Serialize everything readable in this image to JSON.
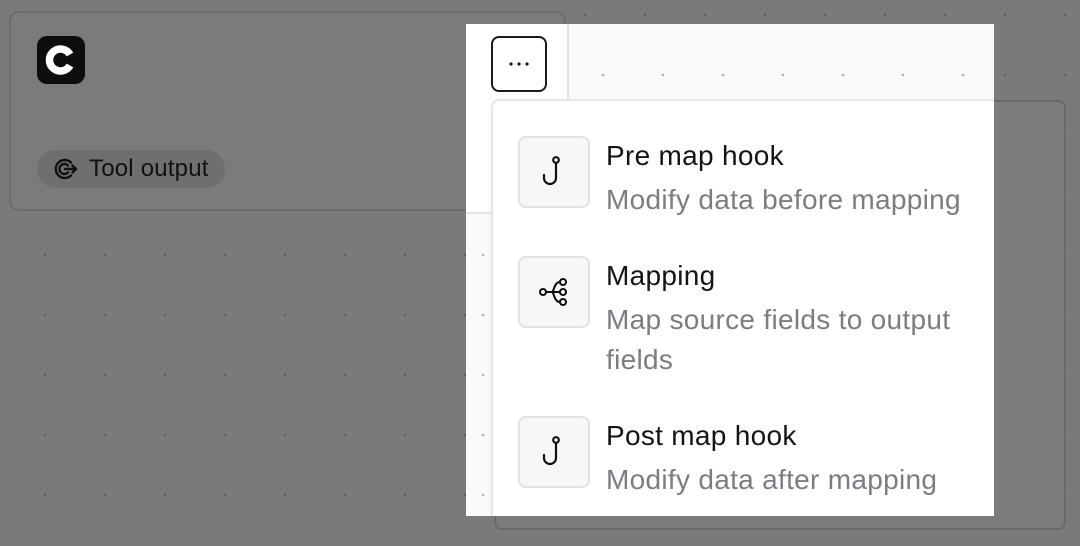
{
  "node": {
    "logo_icon": "letter-c-logo",
    "chip": {
      "icon": "tool-output-icon",
      "label": "Tool output"
    }
  },
  "toolbar": {
    "more_icon": "ellipsis-icon"
  },
  "menu": {
    "items": [
      {
        "icon": "hook-icon",
        "title": "Pre map hook",
        "description": "Modify data before mapping"
      },
      {
        "icon": "mapping-icon",
        "title": "Mapping",
        "description": "Map source fields to output fields"
      },
      {
        "icon": "hook-icon",
        "title": "Post map hook",
        "description": "Modify data after mapping"
      }
    ]
  },
  "colors": {
    "backdrop": "#7a7a7a",
    "menu_background": "#ffffff",
    "title_text": "#141414",
    "description_text": "#7c7c82",
    "logo_background": "#0d0d0d"
  }
}
